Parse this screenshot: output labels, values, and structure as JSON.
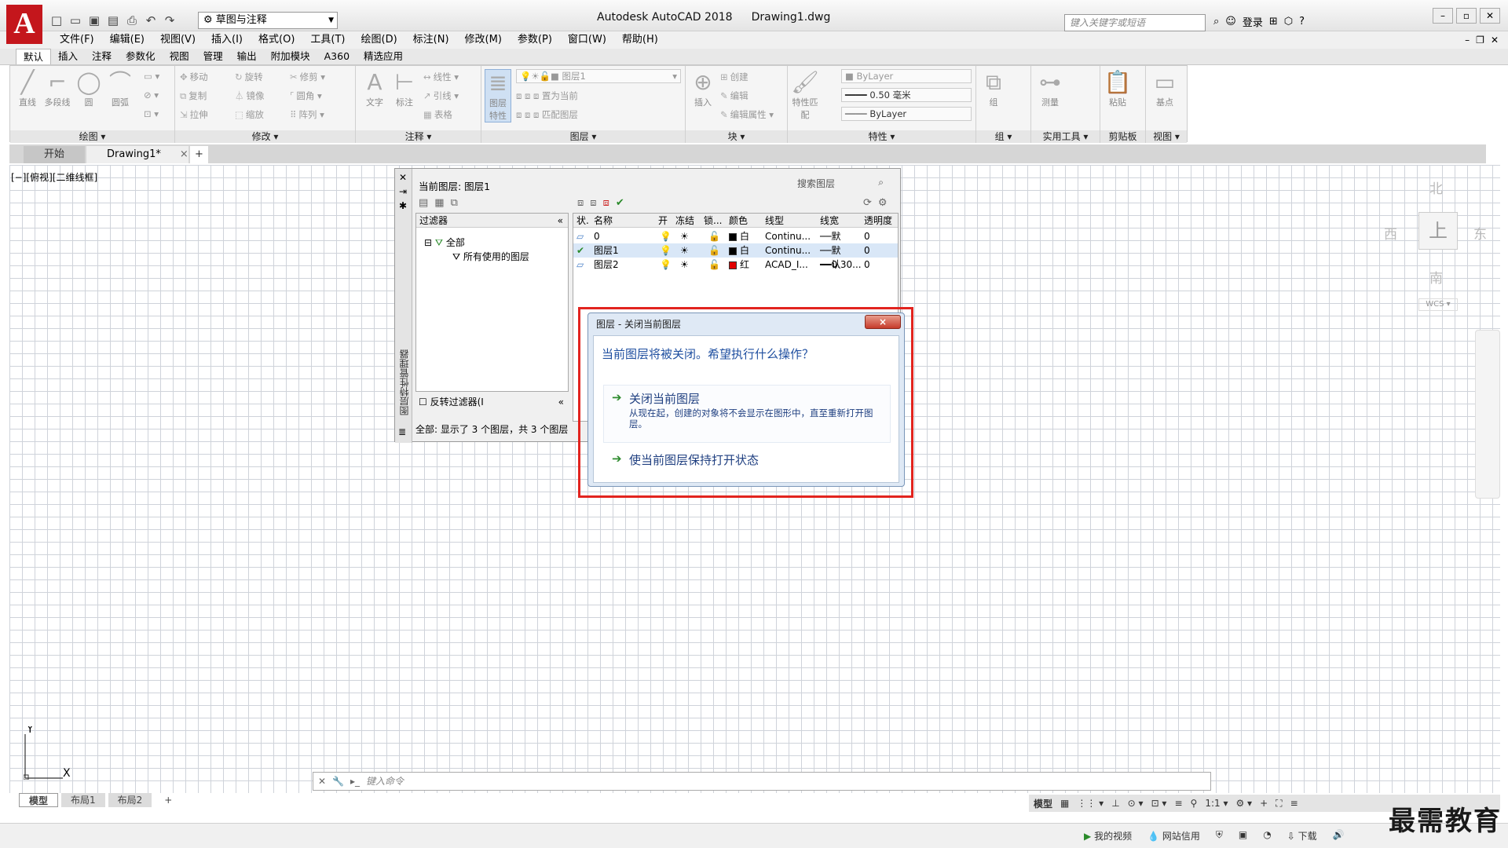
{
  "app": {
    "logo": "A",
    "title": "Autodesk AutoCAD 2018",
    "file": "Drawing1.dwg"
  },
  "qat": {
    "workspace": "草图与注释",
    "icons": [
      "new-icon",
      "open-icon",
      "save-icon",
      "saveas-icon",
      "print-icon",
      "undo-icon",
      "redo-icon"
    ]
  },
  "search": {
    "placeholder": "键入关键字或短语"
  },
  "user": {
    "login": "登录"
  },
  "menubar": [
    "文件(F)",
    "编辑(E)",
    "视图(V)",
    "插入(I)",
    "格式(O)",
    "工具(T)",
    "绘图(D)",
    "标注(N)",
    "修改(M)",
    "参数(P)",
    "窗口(W)",
    "帮助(H)"
  ],
  "ribbon_tabs": [
    "默认",
    "插入",
    "注释",
    "参数化",
    "视图",
    "管理",
    "输出",
    "附加模块",
    "A360",
    "精选应用"
  ],
  "ribbon": {
    "draw": {
      "title": "绘图 ▾",
      "line": "直线",
      "polyline": "多段线",
      "circle": "圆",
      "arc": "圆弧"
    },
    "modify": {
      "title": "修改 ▾",
      "move": "移动",
      "rotate": "旋转",
      "trim": "修剪",
      "copy": "复制",
      "mirror": "镜像",
      "fillet": "圆角",
      "stretch": "拉伸",
      "scale": "缩放",
      "array": "阵列"
    },
    "annotation": {
      "title": "注释 ▾",
      "text": "文字",
      "dim": "标注",
      "linear": "线性",
      "leader": "引线",
      "table": "表格"
    },
    "layers": {
      "title": "图层 ▾",
      "props": "图层特性",
      "current_layer": "图层1",
      "set_current": "置为当前",
      "match": "匹配图层"
    },
    "block": {
      "title": "块 ▾",
      "insert": "插入",
      "create": "创建",
      "edit": "编辑",
      "edit_attr": "编辑属性"
    },
    "properties": {
      "title": "特性 ▾",
      "match": "特性匹配",
      "color": "ByLayer",
      "lineweight": "0.50 毫米",
      "linetype": "ByLayer"
    },
    "group": {
      "title": "组 ▾",
      "group": "组"
    },
    "utilities": {
      "title": "实用工具 ▾",
      "measure": "测量"
    },
    "clipboard": {
      "title": "剪贴板",
      "paste": "粘贴"
    },
    "view": {
      "title": "视图 ▾",
      "base": "基点"
    }
  },
  "doc_tabs": {
    "start": "开始",
    "drawing": "Drawing1*",
    "close": "×",
    "add": "+"
  },
  "viewport_label": "[−][俯视][二维线框]",
  "viewcube": {
    "north": "北",
    "south": "南",
    "east": "东",
    "west": "西",
    "top": "上",
    "wcs": "WCS ▾"
  },
  "ucs": {
    "y": "Y",
    "x": "X"
  },
  "palette": {
    "current": "当前图层: 图层1",
    "search_placeholder": "搜索图层",
    "side_title": "图层特性管理器",
    "filter_header": "过滤器",
    "tree_all": "全部",
    "tree_used": "所有使用的图层",
    "invert": "反转过滤器(I",
    "status": "全部: 显示了 3 个图层，共 3 个图层",
    "columns": [
      "状.",
      "名称",
      "开",
      "冻结",
      "锁...",
      "颜色",
      "线型",
      "线宽",
      "透明度"
    ],
    "rows": [
      {
        "name": "0",
        "color": "白",
        "swatch": "#000000",
        "linetype": "Continu...",
        "lineweight": "默认",
        "transparency": "0"
      },
      {
        "name": "图层1",
        "color": "白",
        "swatch": "#000000",
        "linetype": "Continu...",
        "lineweight": "默认",
        "transparency": "0"
      },
      {
        "name": "图层2",
        "color": "红",
        "swatch": "#e00000",
        "linetype": "ACAD_I...",
        "lineweight": "0.30...",
        "transparency": "0"
      }
    ]
  },
  "dialog": {
    "title": "图层 - 关闭当前图层",
    "close": "×",
    "question": "当前图层将被关闭。希望执行什么操作？",
    "opt1_title": "关闭当前图层",
    "opt1_desc": "从现在起，创建的对象将不会显示在图形中，直至重新打开图层。",
    "opt2_title": "使当前图层保持打开状态"
  },
  "command": {
    "placeholder": "键入命令"
  },
  "layout_tabs": [
    "模型",
    "布局1",
    "布局2",
    "+"
  ],
  "status": {
    "model": "模型",
    "scale": "1:1 ▾"
  },
  "taskbar": {
    "video": "我的视频",
    "credit": "网站信用",
    "download": "下载"
  },
  "watermark": "最需教育"
}
